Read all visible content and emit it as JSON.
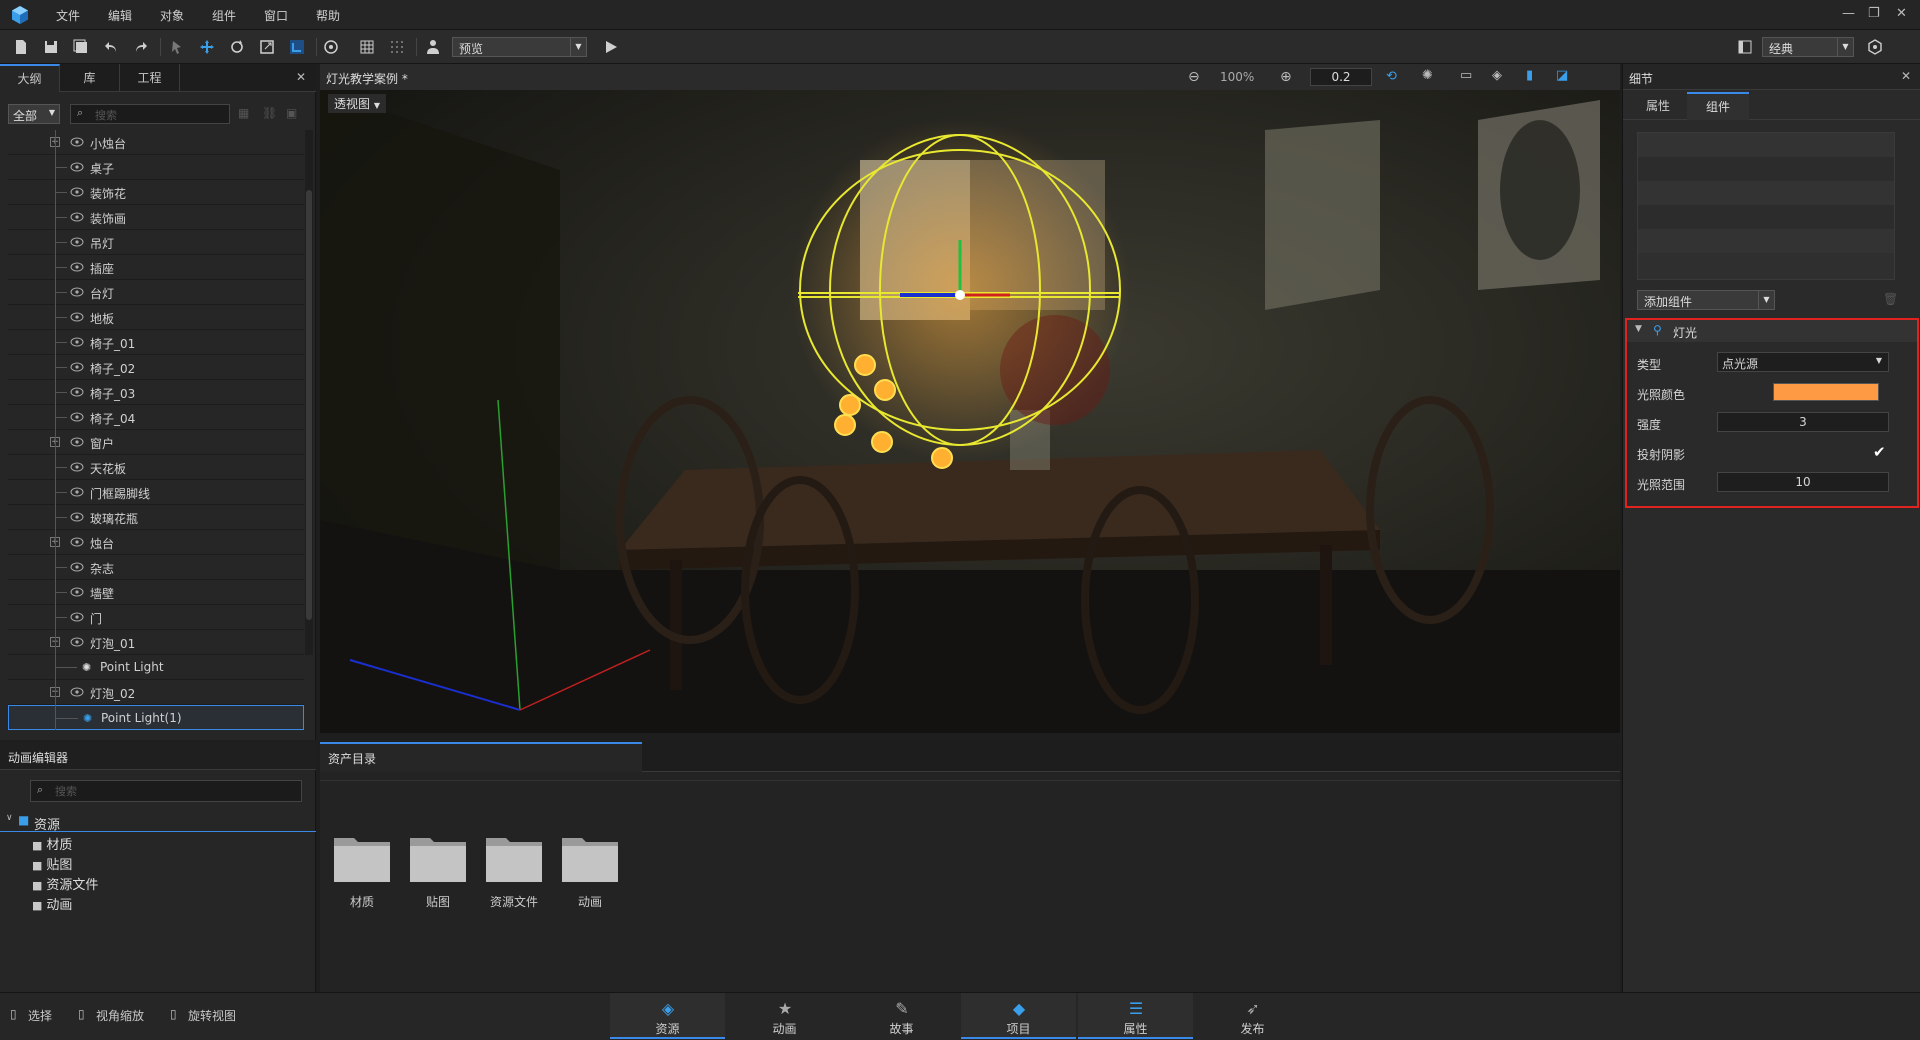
{
  "menu": [
    "文件",
    "编辑",
    "对象",
    "组件",
    "窗口",
    "帮助"
  ],
  "toolbar": {
    "preview_label": "预览",
    "layout_label": "经典"
  },
  "left_panel": {
    "tabs": [
      "大纲",
      "库",
      "工程"
    ],
    "filter_label": "全部",
    "search_placeholder": "搜索",
    "tree": [
      {
        "label": "小烛台",
        "expand": true
      },
      {
        "label": "桌子"
      },
      {
        "label": "装饰花"
      },
      {
        "label": "装饰画"
      },
      {
        "label": "吊灯"
      },
      {
        "label": "插座"
      },
      {
        "label": "台灯"
      },
      {
        "label": "地板"
      },
      {
        "label": "椅子_01"
      },
      {
        "label": "椅子_02"
      },
      {
        "label": "椅子_03"
      },
      {
        "label": "椅子_04"
      },
      {
        "label": "窗户",
        "expand": true
      },
      {
        "label": "天花板"
      },
      {
        "label": "门框踢脚线"
      },
      {
        "label": "玻璃花瓶"
      },
      {
        "label": "烛台",
        "expand": true
      },
      {
        "label": "杂志"
      },
      {
        "label": "墙壁"
      },
      {
        "label": "门"
      },
      {
        "label": "灯泡_01",
        "collapse": true
      },
      {
        "label": "Point Light",
        "child": true
      },
      {
        "label": "灯泡_02",
        "collapse": true
      },
      {
        "label": "Point Light(1)",
        "child": true,
        "selected": true
      }
    ]
  },
  "viewport": {
    "title": "灯光教学案例 *",
    "view_mode": "透视图",
    "zoom": "100%",
    "snap": "0.2"
  },
  "right_panel": {
    "title": "细节",
    "tabs": [
      "属性",
      "组件"
    ],
    "add_component": "添加组件",
    "component_name": "灯光",
    "props": {
      "type_label": "类型",
      "type_value": "点光源",
      "color_label": "光照颜色",
      "color_value": "#ff9a44",
      "intensity_label": "强度",
      "intensity_value": "3",
      "shadow_label": "投射阴影",
      "shadow_checked": true,
      "range_label": "光照范围",
      "range_value": "10"
    }
  },
  "anim_panel": {
    "title": "动画编辑器",
    "search_placeholder": "搜索",
    "tree_root": "资源",
    "tree_items": [
      "材质",
      "贴图",
      "资源文件",
      "动画"
    ]
  },
  "assets_panel": {
    "tab": "资产目录",
    "folders": [
      "材质",
      "贴图",
      "资源文件",
      "动画"
    ]
  },
  "statusbar": {
    "tools": [
      "选择",
      "视角缩放",
      "旋转视图"
    ],
    "nav": [
      {
        "label": "资源",
        "active": true
      },
      {
        "label": "动画"
      },
      {
        "label": "故事"
      },
      {
        "label": "项目",
        "active": true
      },
      {
        "label": "属性",
        "active": true
      },
      {
        "label": "发布"
      }
    ]
  },
  "colors": {
    "accent": "#3a88e8",
    "highlight_red": "#e0231f",
    "light_color": "#ff9a44"
  }
}
